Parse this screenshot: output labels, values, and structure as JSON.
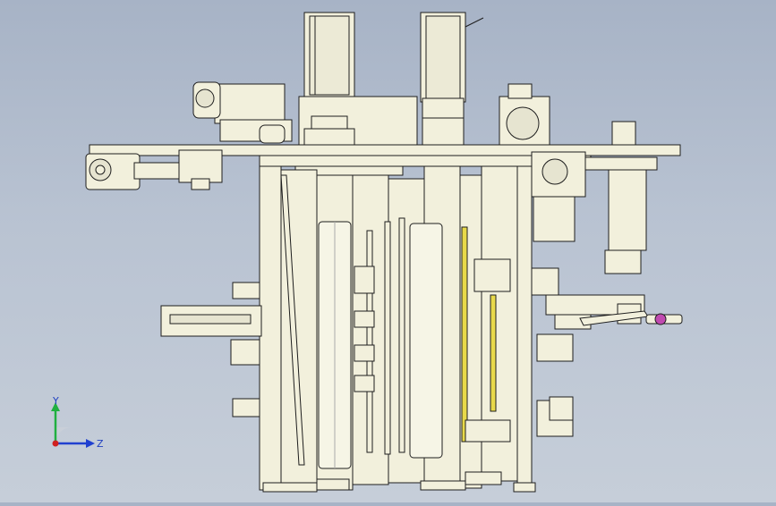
{
  "view": {
    "background_top": "#a7b3c6",
    "background_bottom": "#c6ced9",
    "part_color": "#f2f0dc",
    "edge_color": "#1e1e1e",
    "highlight_color": "#e8d94a",
    "accent_color": "#c04ab0"
  },
  "triad": {
    "y_label": "Y",
    "z_label": "Z",
    "y_color": "#20b040",
    "z_color": "#2040d0",
    "x_color": "#d02020"
  }
}
